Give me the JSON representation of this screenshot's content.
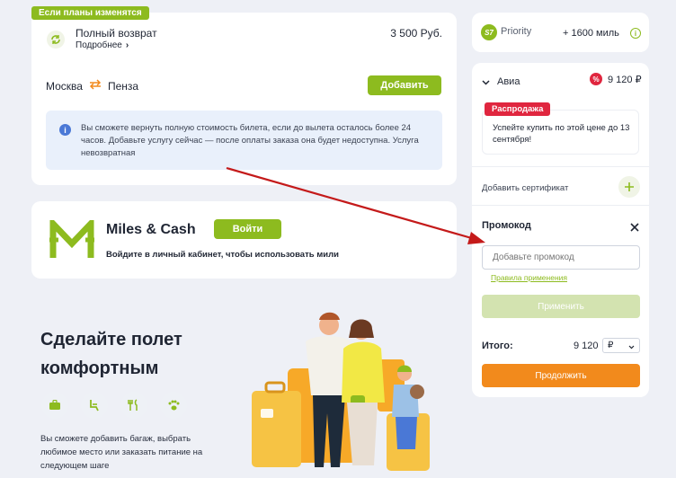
{
  "refund": {
    "badge": "Если планы изменятся",
    "title": "Полный возврат",
    "more": "Подробнее",
    "more_arrow": "›",
    "price": "3 500 Руб.",
    "from": "Москва",
    "to": "Пенза",
    "add_label": "Добавить",
    "info_text": "Вы сможете вернуть полную стоимость билета, если до вылета осталось более 24 часов. Добавьте услугу сейчас — после оплаты заказа она будет недоступна. Услуга невозвратная"
  },
  "miles": {
    "title": "Miles & Cash",
    "login_label": "Войти",
    "subtitle": "Войдите в личный кабинет, чтобы использовать мили"
  },
  "promo": {
    "title_line1": "Сделайте полет",
    "title_line2": "комфортным",
    "description": "Вы сможете добавить багаж, выбрать любимое место или заказать питание на следующем шаге",
    "icons": [
      "baggage-icon",
      "seat-icon",
      "meal-icon",
      "pet-icon"
    ]
  },
  "priority": {
    "logo_text": "S7",
    "label": "Priority",
    "miles": "+ 1600 миль",
    "info": "i"
  },
  "order": {
    "section": "Авиа",
    "discount_symbol": "%",
    "price": "9 120 ₽",
    "sale_badge": "Распродажа",
    "sale_text": "Успейте купить по этой цене до 13 сентября!",
    "certificate_label": "Добавить сертификат",
    "promo_title": "Промокод",
    "promo_placeholder": "Добавьте промокод",
    "rules_link": "Правила применения",
    "apply_label": "Применить",
    "total_label": "Итого:",
    "total_value": "9 120",
    "currency": "₽",
    "continue_label": "Продолжить"
  },
  "colors": {
    "accent_green": "#8dbb1f",
    "orange": "#f28a1c",
    "info_bg": "#e9f0fb",
    "info_icon": "#4a78d6",
    "sale_red": "#e0263f",
    "arrow_red": "#c41a1a"
  }
}
